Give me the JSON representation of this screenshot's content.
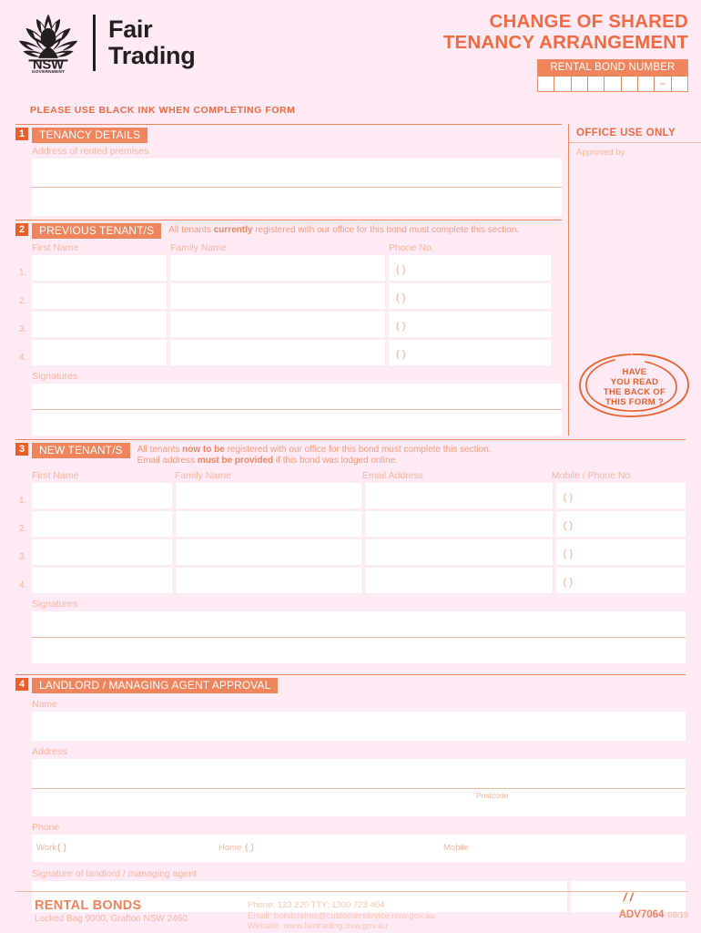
{
  "colors": {
    "page_bg": "#fdeaf5",
    "accent": "#f0845c",
    "accent_dark": "#ec5f2b",
    "accent_light": "#f9b49a",
    "logo_black": "#231f20",
    "field_white": "#ffffff"
  },
  "header": {
    "logo": {
      "icon": "waratah-flower-icon",
      "jurisdiction": "NSW",
      "jurisdiction_sub": "GOVERNMENT",
      "agency_line1": "Fair",
      "agency_line2": "Trading"
    },
    "title_line1": "CHANGE OF SHARED",
    "title_line2": "TENANCY ARRANGEMENT",
    "bond": {
      "label": "RENTAL BOND NUMBER",
      "cells": [
        "",
        "",
        "",
        "",
        "",
        "",
        "",
        "–",
        ""
      ]
    },
    "ink_note": "PLEASE USE BLACK INK WHEN COMPLETING FORM"
  },
  "office_use": {
    "title": "OFFICE USE ONLY",
    "approved_by_label": "Approved by",
    "stamp_line1": "HAVE",
    "stamp_line2": "YOU READ",
    "stamp_line3": "THE BACK OF",
    "stamp_line4": "THIS FORM ?"
  },
  "section1": {
    "number": "1",
    "name": "TENANCY DETAILS",
    "address_label": "Address of rented premises"
  },
  "section2": {
    "number": "2",
    "name": "PREVIOUS TENANT/S",
    "note_pre": "All tenants ",
    "note_bold": "currently",
    "note_post": " registered with our office for this bond must complete this section.",
    "columns": [
      "First Name",
      "Family Name",
      "Phone No."
    ],
    "rows": [
      {
        "num": "1.",
        "first_name": "",
        "family_name": "",
        "phone": "(    )"
      },
      {
        "num": "2.",
        "first_name": "",
        "family_name": "",
        "phone": "(    )"
      },
      {
        "num": "3.",
        "first_name": "",
        "family_name": "",
        "phone": "(    )"
      },
      {
        "num": "4.",
        "first_name": "",
        "family_name": "",
        "phone": "(    )"
      }
    ],
    "signatures_label": "Signatures"
  },
  "section3": {
    "number": "3",
    "name": "NEW TENANT/S",
    "note_line1_pre": "All tenants ",
    "note_line1_bold": "now to be",
    "note_line1_post": " registered with our office for this bond must complete this section.",
    "note_line2_pre": "Email address ",
    "note_line2_bold": "must be provided",
    "note_line2_post": " if this bond was lodged online.",
    "columns": [
      "First Name",
      "Family Name",
      "Email Address",
      "Mobile / Phone No."
    ],
    "rows": [
      {
        "num": "1.",
        "first_name": "",
        "family_name": "",
        "email": "",
        "phone": "(    )"
      },
      {
        "num": "2.",
        "first_name": "",
        "family_name": "",
        "email": "",
        "phone": "(    )"
      },
      {
        "num": "3.",
        "first_name": "",
        "family_name": "",
        "email": "",
        "phone": "(    )"
      },
      {
        "num": "4.",
        "first_name": "",
        "family_name": "",
        "email": "",
        "phone": "(    )"
      }
    ],
    "signatures_label": "Signatures"
  },
  "section4": {
    "number": "4",
    "name": "LANDLORD / MANAGING AGENT APPROVAL",
    "name_label": "Name",
    "address_label": "Address",
    "postcode_label": "Postcode",
    "phone_label": "Phone",
    "work_label": "Work",
    "work_value": "(    )",
    "home_label": "Home",
    "home_value": "(    )",
    "mobile_label": "Mobile",
    "signature_label": "Signature of landlord / managing agent",
    "date_value": "/      /"
  },
  "footer": {
    "title": "RENTAL BONDS",
    "address": "Locked Bag 9000, Grafton NSW 2460",
    "phone_line": "Phone: 133 220     TTY: 1300 723 404",
    "email_line": "Email: bondclaims@customerservice.nsw.gov.au",
    "website_line": "Website: www.fairtrading.nsw.gov.au",
    "form_code": "ADV7064",
    "form_date": "08/19"
  }
}
